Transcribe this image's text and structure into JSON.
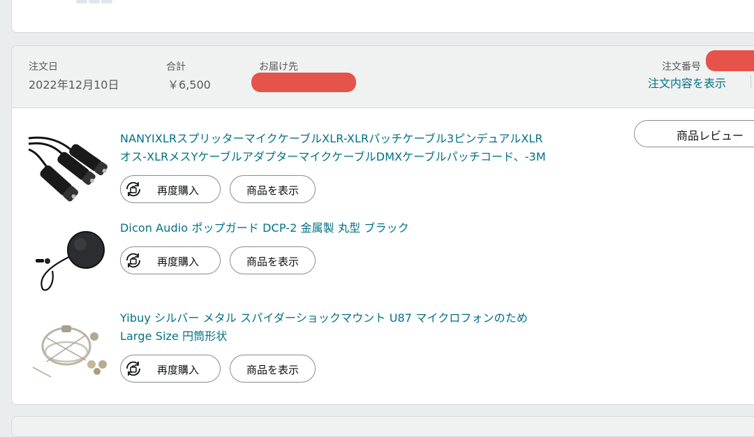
{
  "order": {
    "date_label": "注文日",
    "date_value": "2022年12月10日",
    "total_label": "合計",
    "total_value": "￥6,500",
    "ship_to_label": "お届け先",
    "order_number_label": "注文番号",
    "view_details_link": "注文内容を表示"
  },
  "actions": {
    "review_button": "商品レビュー",
    "buy_again": "再度購入",
    "view_item": "商品を表示"
  },
  "items": [
    {
      "title_line1": "NANYIXLRスプリッターマイクケーブルXLR-XLRパッチケーブル3ピンデュアルXLR",
      "title_line2": "オス-XLRメスYケーブルアダプターマイクケーブルDMXケーブルパッチコード、-3M",
      "image_icon": "xlr-cable-image"
    },
    {
      "title_line1": "Dicon Audio ポップガード DCP-2 金属製 丸型 ブラック",
      "image_icon": "pop-filter-image"
    },
    {
      "title_line1": "Yibuy シルバー メタル スパイダーショックマウント U87 マイクロフォンのため",
      "title_line2": "Large Size 円筒形状",
      "image_icon": "shock-mount-image"
    }
  ],
  "colors": {
    "link": "#007185",
    "header_bg": "#f0f2f2",
    "redaction": "#e5534b",
    "border": "#d5d9d9"
  }
}
